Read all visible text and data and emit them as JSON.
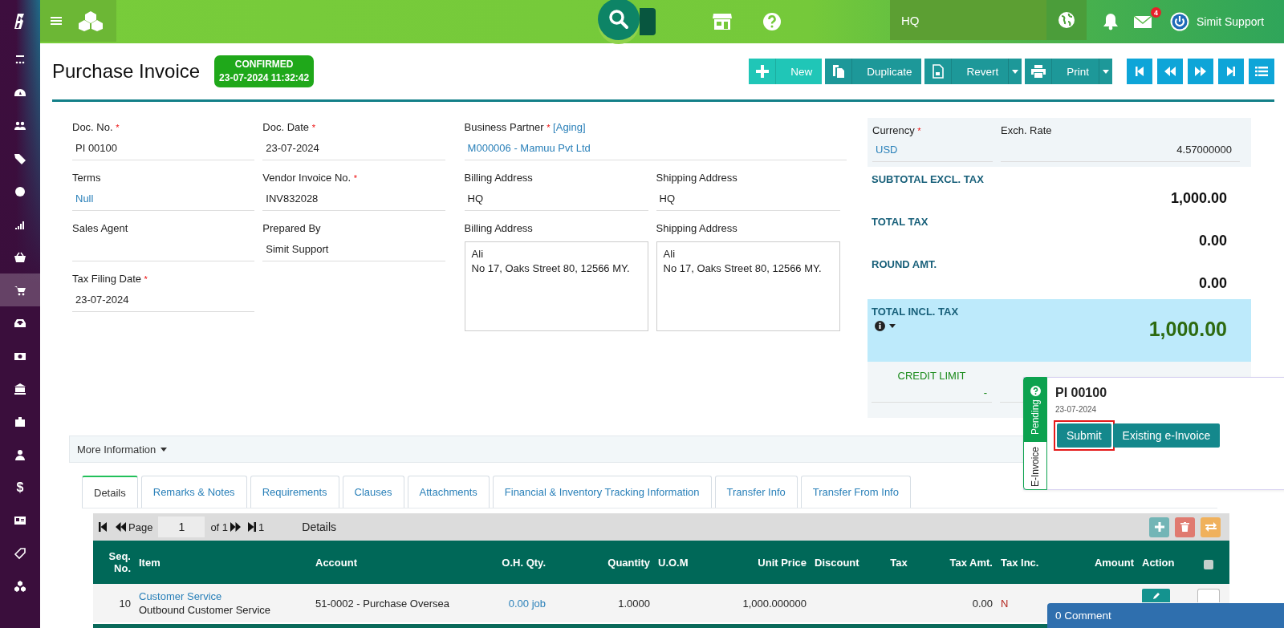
{
  "sidebar": {
    "items": [
      {
        "selected": false
      },
      {
        "selected": false
      },
      {
        "selected": false
      },
      {
        "selected": false
      },
      {
        "selected": false
      },
      {
        "selected": false
      },
      {
        "selected": false
      },
      {
        "selected": true
      },
      {
        "selected": false
      },
      {
        "selected": false
      },
      {
        "selected": false
      },
      {
        "selected": false
      },
      {
        "selected": false
      },
      {
        "selected": false,
        "glyph": "$"
      },
      {
        "selected": false
      },
      {
        "selected": false
      },
      {
        "selected": false
      }
    ]
  },
  "topbar": {
    "branch": "HQ",
    "mail_count": "4",
    "user": "Simit Support"
  },
  "page": {
    "title": "Purchase Invoice",
    "status": "CONFIRMED",
    "status_time": "23-07-2024 11:32:42"
  },
  "toolbar": {
    "buttons": [
      {
        "label": "New",
        "kind": "new",
        "dropdown": false
      },
      {
        "label": "Duplicate",
        "kind": "duplicate",
        "dropdown": false
      },
      {
        "label": "Revert",
        "kind": "revert",
        "dropdown": true
      },
      {
        "label": "Print",
        "kind": "print",
        "dropdown": true
      }
    ],
    "nav": [
      {
        "kind": "first"
      },
      {
        "kind": "prev"
      },
      {
        "kind": "next"
      },
      {
        "kind": "last"
      },
      {
        "kind": "list"
      }
    ]
  },
  "form": {
    "columns": [
      [
        {
          "label": "Doc. No.",
          "mark": "*",
          "value": "PI 00100",
          "kind": "text"
        },
        {
          "label": "Terms",
          "value": "Null",
          "kind": "link"
        },
        {
          "label": "Sales Agent",
          "kind": "text"
        },
        {
          "label": "Tax Filing Date",
          "mark": "*",
          "value": "23-07-2024",
          "kind": "text"
        }
      ],
      [
        {
          "label": "Doc. Date",
          "mark": "*",
          "value": "23-07-2024",
          "kind": "text"
        },
        {
          "label": "Vendor Invoice No.",
          "mark": "*",
          "value": "INV832028",
          "kind": "text"
        },
        {
          "label": "Prepared By",
          "value": "Simit Support",
          "kind": "text"
        }
      ]
    ],
    "business_partner": {
      "label": "Business Partner",
      "mark": "*",
      "extra": "[Aging]",
      "value": "M000006 - Mamuu Pvt Ltd"
    },
    "address_columns": [
      [
        {
          "label": "Billing Address",
          "value": "HQ",
          "kind": "text"
        },
        {
          "label": "Billing Address",
          "lines": [
            "Ali",
            "No 17, Oaks Street 80, 12566 MY."
          ],
          "kind": "box"
        }
      ],
      [
        {
          "label": "Shipping Address",
          "value": "HQ",
          "kind": "text"
        },
        {
          "label": "Shipping Address",
          "lines": [
            "Ali",
            "No 17, Oaks Street 80, 12566 MY."
          ],
          "kind": "box"
        }
      ]
    ]
  },
  "summary": {
    "currency": {
      "label": "Currency",
      "mark": "*",
      "value": "USD"
    },
    "exch_rate": {
      "label": "Exch. Rate",
      "value": "4.57000000"
    },
    "totals": [
      {
        "label": "SUBTOTAL EXCL. TAX",
        "value": "1,000.00",
        "kind": "plain"
      },
      {
        "label": "TOTAL TAX",
        "value": "0.00",
        "kind": "plain"
      },
      {
        "label": "ROUND AMT.",
        "value": "0.00",
        "kind": "plain"
      },
      {
        "label": "TOTAL INCL. TAX",
        "value": "1,000.00",
        "kind": "grand"
      }
    ],
    "credit": {
      "label": "CREDIT LIMIT",
      "value": "-"
    }
  },
  "einvoice": {
    "status": "Pending",
    "tab": "E-Invoice",
    "doc": "PI 00100",
    "date": "23-07-2024",
    "buttons": [
      {
        "label": "Submit",
        "highlighted": true
      },
      {
        "label": "Existing e-Invoice",
        "highlighted": false
      }
    ]
  },
  "more_info": {
    "label": "More Information"
  },
  "tabs": [
    {
      "label": "Details",
      "selected": true
    },
    {
      "label": "Remarks & Notes",
      "selected": false
    },
    {
      "label": "Requirements",
      "selected": false
    },
    {
      "label": "Clauses",
      "selected": false
    },
    {
      "label": "Attachments",
      "selected": false
    },
    {
      "label": "Financial & Inventory Tracking Information",
      "selected": false
    },
    {
      "label": "Transfer Info",
      "selected": false
    },
    {
      "label": "Transfer From Info",
      "selected": false
    }
  ],
  "pager": {
    "page_label": "Page",
    "page": "1",
    "of": "of 1",
    "count": "1",
    "title": "Details"
  },
  "table": {
    "columns": [
      "Seq. No.",
      "Item",
      "Account",
      "O.H. Qty.",
      "Quantity",
      "U.O.M",
      "Unit Price",
      "Discount",
      "Tax",
      "Tax Amt.",
      "Tax Inc.",
      "Amount",
      "Action"
    ],
    "select_all_checked": false,
    "rows": [
      {
        "checked": false,
        "seq": "10",
        "item": "Customer Service",
        "item_desc": "Outbound Customer Service",
        "account": "51-0002 - Purchase Oversea",
        "oh_qty": "0.00 job",
        "quantity": "1.0000",
        "unit_price": "1,000.000000",
        "tax_amt": "0.00",
        "tax_inc": "N"
      }
    ]
  },
  "comments": {
    "label": "0 Comment"
  }
}
